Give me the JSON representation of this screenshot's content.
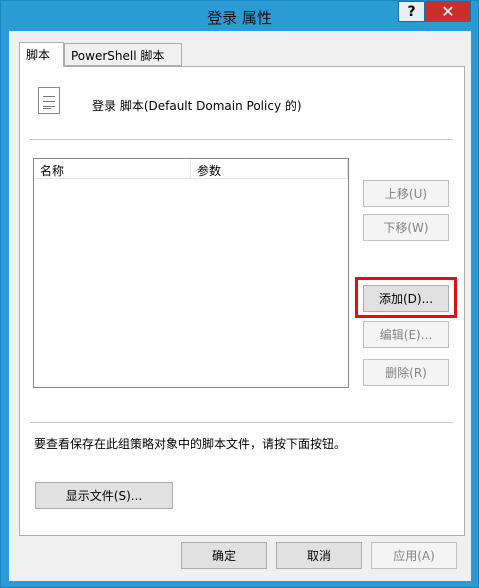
{
  "window": {
    "title": "登录 属性",
    "help_label": "?",
    "close_label": "✕"
  },
  "tabs": [
    {
      "label": "脚本",
      "active": true
    },
    {
      "label": "PowerShell 脚本",
      "active": false
    }
  ],
  "panel": {
    "heading": "登录 脚本(Default Domain Policy 的)",
    "list": {
      "columns": [
        "名称",
        "参数"
      ],
      "rows": []
    },
    "buttons": {
      "up": "上移(U)",
      "down": "下移(W)",
      "add": "添加(D)...",
      "edit": "编辑(E)...",
      "remove": "删除(R)"
    },
    "hint": "要查看保存在此组策略对象中的脚本文件，请按下面按钮。",
    "show_files": "显示文件(S)..."
  },
  "footer": {
    "ok": "确定",
    "cancel": "取消",
    "apply": "应用(A)"
  },
  "colors": {
    "titlebar": "#2b9bd6",
    "close": "#c9302c",
    "highlight": "#e01010"
  }
}
